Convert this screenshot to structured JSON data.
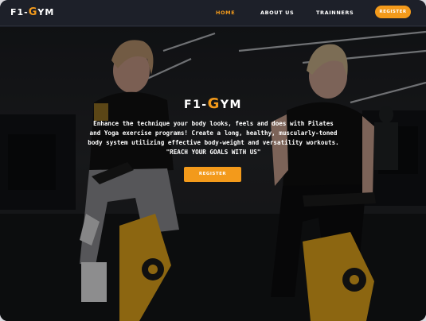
{
  "brand": {
    "prefix": "F1-",
    "accent_letter": "G",
    "suffix": "YM",
    "accent_color": "#f39a1b"
  },
  "nav": {
    "items": [
      {
        "label": "HOME",
        "active": true
      },
      {
        "label": "ABOUT US",
        "active": false
      },
      {
        "label": "TRAINNERS",
        "active": false
      }
    ],
    "register_label": "REGISTER"
  },
  "hero": {
    "background_image": "two women riding stationary spin bikes in a dimly lit gym",
    "description": "Enhance the technique your body looks, feels and does with Pilates and Yoga exercise programs! Create a long, healthy, muscularly-toned body system utilizing effective body-weight and versatility workouts.",
    "slogan": "\"REACH YOUR GOALS WITH US\"",
    "register_label": "REGISTER"
  },
  "colors": {
    "accent": "#f39a1b",
    "navbar": "#1d2029",
    "text": "#ffffff"
  }
}
